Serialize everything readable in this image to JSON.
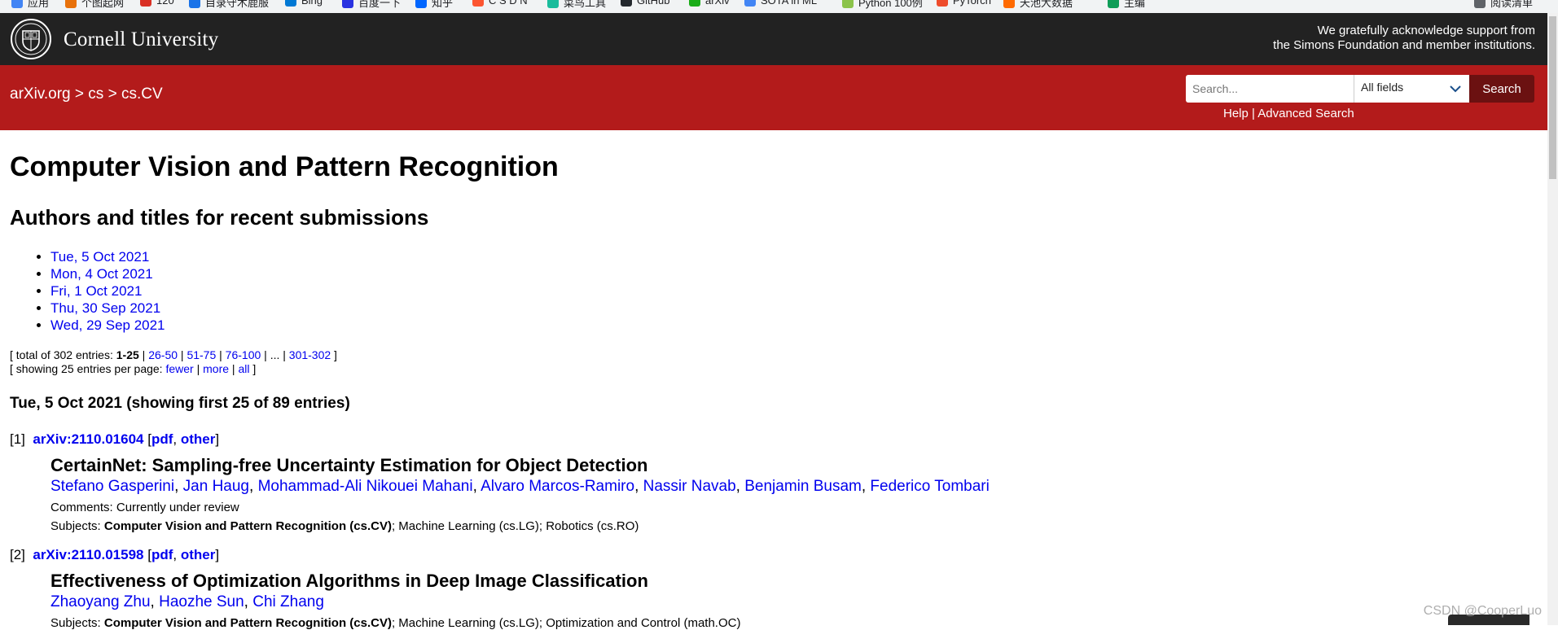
{
  "bookmarks": [
    {
      "label": "应用",
      "color": "#4285f4"
    },
    {
      "label": "个图起网",
      "color": "#e8710a"
    },
    {
      "label": "120",
      "color": "#d93025"
    },
    {
      "label": "目录守木鹿服",
      "color": "#1a73e8"
    },
    {
      "label": "Bing",
      "color": "#0078d4"
    },
    {
      "label": "百度一下",
      "color": "#2932e1"
    },
    {
      "label": "知乎",
      "color": "#0066ff"
    },
    {
      "label": "C S D N",
      "color": "#fc5531"
    },
    {
      "label": "菜鸟工具",
      "color": "#1abc9c"
    },
    {
      "label": "GitHub",
      "color": "#24292e"
    },
    {
      "label": "arXiv",
      "color": "#1aad19"
    },
    {
      "label": "SOTA in ML",
      "color": "#4285f4"
    },
    {
      "label": "Python 100例",
      "color": "#8bc34a"
    },
    {
      "label": "PyTorch",
      "color": "#ee4c2c"
    },
    {
      "label": "天池大数据",
      "color": "#ff6a00"
    },
    {
      "label": "主编",
      "color": "#0f9d58"
    },
    {
      "label": "阅读清单",
      "color": "#5f6368"
    }
  ],
  "cornell": {
    "name": "Cornell University",
    "ack_line1": "We gratefully acknowledge support from",
    "ack_line2": "the Simons Foundation and member institutions."
  },
  "nav": {
    "breadcrumb": [
      "arXiv.org",
      "cs",
      "cs.CV"
    ],
    "separator": ">",
    "search_placeholder": "Search...",
    "field_selected": "All fields",
    "search_button": "Search",
    "help": "Help",
    "help_sep": "|",
    "advanced": "Advanced Search"
  },
  "page": {
    "title": "Computer Vision and Pattern Recognition",
    "subtitle": "Authors and titles for recent submissions",
    "dates": [
      "Tue, 5 Oct 2021",
      "Mon, 4 Oct 2021",
      "Fri, 1 Oct 2021",
      "Thu, 30 Sep 2021",
      "Wed, 29 Sep 2021"
    ],
    "paging": {
      "prefix": "[ total of 302 entries: ",
      "current": "1-25",
      "pages": [
        "26-50",
        "51-75",
        "76-100"
      ],
      "ellipsis": "...",
      "last": "301-302",
      "suffix": " ]",
      "per_page_prefix": "[ showing 25 entries per page: ",
      "fewer": "fewer",
      "more": "more",
      "all": "all",
      "per_page_suffix": " ]"
    },
    "section_heading": "Tue, 5 Oct 2021 (showing first 25 of 89 entries)"
  },
  "entries": [
    {
      "index": "[1]",
      "id": "arXiv:2110.01604",
      "pdf": "pdf",
      "other": "other",
      "title": "CertainNet: Sampling-free Uncertainty Estimation for Object Detection",
      "authors": [
        "Stefano Gasperini",
        "Jan Haug",
        "Mohammad-Ali Nikouei Mahani",
        "Alvaro Marcos-Ramiro",
        "Nassir Navab",
        "Benjamin Busam",
        "Federico Tombari"
      ],
      "comments_label": "Comments:",
      "comments": "Currently under review",
      "subjects_label": "Subjects:",
      "primary_subject": "Computer Vision and Pattern Recognition (cs.CV)",
      "other_subjects": "; Machine Learning (cs.LG); Robotics (cs.RO)"
    },
    {
      "index": "[2]",
      "id": "arXiv:2110.01598",
      "pdf": "pdf",
      "other": "other",
      "title": "Effectiveness of Optimization Algorithms in Deep Image Classification",
      "authors": [
        "Zhaoyang Zhu",
        "Haozhe Sun",
        "Chi Zhang"
      ],
      "subjects_label": "Subjects:",
      "primary_subject": "Computer Vision and Pattern Recognition (cs.CV)",
      "other_subjects": "; Machine Learning (cs.LG); Optimization and Control (math.OC)"
    }
  ],
  "watermark": "CSDN @CooperLuo"
}
